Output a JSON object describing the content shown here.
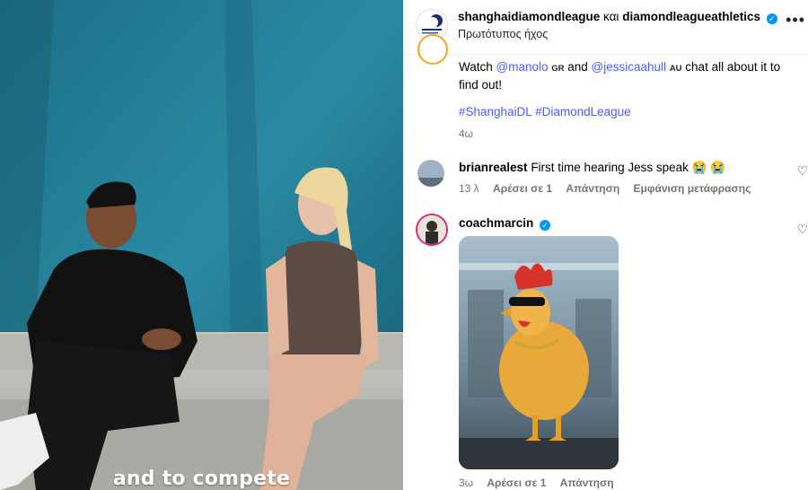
{
  "video": {
    "caption": "and to compete"
  },
  "header": {
    "account1": "shanghaidiamondleague",
    "connector": "και",
    "account2": "diamondleagueathletics",
    "audio": "Πρωτότυπος ήχος",
    "more": "..."
  },
  "post": {
    "text_prefix": "Watch ",
    "mention1": "@manolo",
    "tag1": "GR",
    "and": " and ",
    "mention2": "@jessicaahull",
    "tag2": "AU",
    "text_suffix": " chat all about it to find out!",
    "hashtags": "#ShanghaiDL #DiamondLeague",
    "age": "4ω"
  },
  "comments": [
    {
      "username": "brianrealest",
      "text": "First time hearing Jess speak 😭 😭",
      "age": "13 λ",
      "likes": "Αρέσει σε 1",
      "reply": "Απάντηση",
      "translate": "Εμφάνιση μετάφρασης"
    },
    {
      "username": "coachmarcin",
      "age": "3ω",
      "likes": "Αρέσει σε 1",
      "reply": "Απάντηση"
    }
  ],
  "colors": {
    "link": "#4a5df9",
    "verified": "#0095f6",
    "meta": "#737373"
  }
}
